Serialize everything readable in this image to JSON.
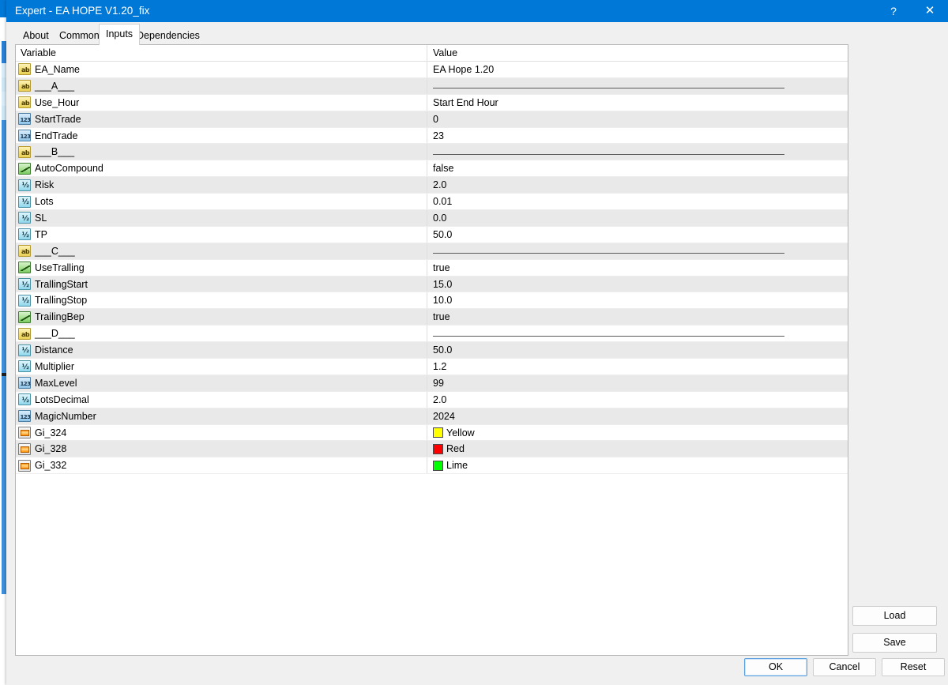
{
  "window": {
    "title": "Expert - EA HOPE V1.20_fix",
    "help_label": "?",
    "close_label": "✕"
  },
  "tabs": [
    {
      "label": "About",
      "selected": false
    },
    {
      "label": "Common",
      "selected": false
    },
    {
      "label": "Inputs",
      "selected": true
    },
    {
      "label": "Dependencies",
      "selected": false
    }
  ],
  "grid": {
    "headers": {
      "variable": "Variable",
      "value": "Value"
    },
    "rows": [
      {
        "icon": "string",
        "name": "EA_Name",
        "value": "EA Hope 1.20",
        "kind": "text"
      },
      {
        "icon": "string",
        "name": "___A___",
        "value": "",
        "kind": "separator"
      },
      {
        "icon": "string",
        "name": "Use_Hour",
        "value": "Start End Hour",
        "kind": "text"
      },
      {
        "icon": "integer",
        "name": "StartTrade",
        "value": "0",
        "kind": "text"
      },
      {
        "icon": "integer",
        "name": "EndTrade",
        "value": "23",
        "kind": "text"
      },
      {
        "icon": "string",
        "name": "___B___",
        "value": "",
        "kind": "separator"
      },
      {
        "icon": "boolean",
        "name": "AutoCompound",
        "value": "false",
        "kind": "text"
      },
      {
        "icon": "double",
        "name": "Risk",
        "value": "2.0",
        "kind": "text"
      },
      {
        "icon": "double",
        "name": "Lots",
        "value": "0.01",
        "kind": "text"
      },
      {
        "icon": "double",
        "name": "SL",
        "value": "0.0",
        "kind": "text"
      },
      {
        "icon": "double",
        "name": "TP",
        "value": "50.0",
        "kind": "text"
      },
      {
        "icon": "string",
        "name": "___C___",
        "value": "",
        "kind": "separator"
      },
      {
        "icon": "boolean",
        "name": "UseTralling",
        "value": "true",
        "kind": "text"
      },
      {
        "icon": "double",
        "name": "TrallingStart",
        "value": "15.0",
        "kind": "text"
      },
      {
        "icon": "double",
        "name": "TrallingStop",
        "value": "10.0",
        "kind": "text"
      },
      {
        "icon": "boolean",
        "name": "TrailingBep",
        "value": "true",
        "kind": "text"
      },
      {
        "icon": "string",
        "name": "___D___",
        "value": "",
        "kind": "separator"
      },
      {
        "icon": "double",
        "name": "Distance",
        "value": "50.0",
        "kind": "text"
      },
      {
        "icon": "double",
        "name": "Multiplier",
        "value": "1.2",
        "kind": "text"
      },
      {
        "icon": "integer",
        "name": "MaxLevel",
        "value": "99",
        "kind": "text"
      },
      {
        "icon": "double",
        "name": "LotsDecimal",
        "value": "2.0",
        "kind": "text"
      },
      {
        "icon": "integer",
        "name": "MagicNumber",
        "value": "2024",
        "kind": "text"
      },
      {
        "icon": "color",
        "name": "Gi_324",
        "value": "Yellow",
        "kind": "color",
        "swatch": "#FFFF00"
      },
      {
        "icon": "color",
        "name": "Gi_328",
        "value": "Red",
        "kind": "color",
        "swatch": "#FF0000"
      },
      {
        "icon": "color",
        "name": "Gi_332",
        "value": "Lime",
        "kind": "color",
        "swatch": "#00FF00"
      }
    ]
  },
  "side_buttons": {
    "load": "Load",
    "save": "Save"
  },
  "bottom_buttons": {
    "ok": "OK",
    "cancel": "Cancel",
    "reset": "Reset"
  },
  "colors": {
    "titlebar": "#0078d7",
    "dialog_bg": "#f0f0f0",
    "row_alt": "#e9e9e9",
    "focus_border": "#5ba1e0"
  }
}
